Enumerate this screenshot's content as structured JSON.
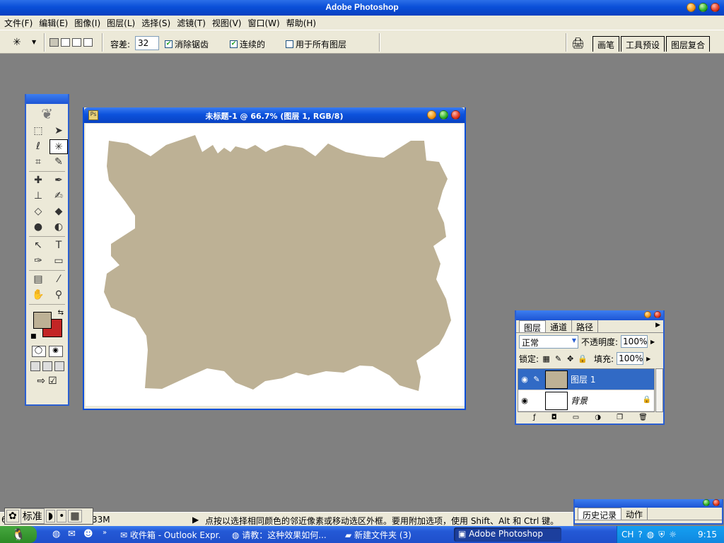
{
  "app": {
    "title": "Adobe Photoshop"
  },
  "menu": [
    "文件(F)",
    "编辑(E)",
    "图像(I)",
    "图层(L)",
    "选择(S)",
    "滤镜(T)",
    "视图(V)",
    "窗口(W)",
    "帮助(H)"
  ],
  "options": {
    "tolerance_label": "容差:",
    "tolerance_value": "32",
    "antialias": {
      "label": "消除锯齿",
      "checked": true
    },
    "contiguous": {
      "label": "连续的",
      "checked": true
    },
    "all_layers": {
      "label": "用于所有图层",
      "checked": false
    },
    "wells": [
      "画笔",
      "工具预设",
      "图层复合"
    ]
  },
  "document": {
    "title": "未标题-1 @ 66.7% (图层 1, RGB/8)",
    "shape_color": "#bdb195"
  },
  "toolbox": {
    "foreground_color": "#bdb195",
    "background_color": "#c32525"
  },
  "layers_panel": {
    "tabs": [
      "图层",
      "通道",
      "路径"
    ],
    "blend_mode": "正常",
    "opacity_label": "不透明度:",
    "opacity": "100%",
    "lock_label": "锁定:",
    "fill_label": "填充:",
    "fill": "100%",
    "layers": [
      {
        "name": "图层 1",
        "selected": true
      },
      {
        "name": "背景",
        "selected": false,
        "locked": true
      }
    ]
  },
  "history_panel": {
    "tabs": [
      "历史记录",
      "动作"
    ]
  },
  "status": {
    "zoom": "6",
    "doc_size": "33M",
    "hint": "点按以选择相同颜色的邻近像素或移动选区外框。要用附加选项，使用 Shift、Alt 和 Ctrl 键。"
  },
  "ime": {
    "mode": "标准"
  },
  "taskbar": {
    "tasks": [
      "收件箱 - Outlook Expr...",
      "请教：这种效果如何...",
      "新建文件夹 (3)",
      "Adobe Photoshop"
    ],
    "tray_lang": "CH",
    "clock": "9:15"
  }
}
